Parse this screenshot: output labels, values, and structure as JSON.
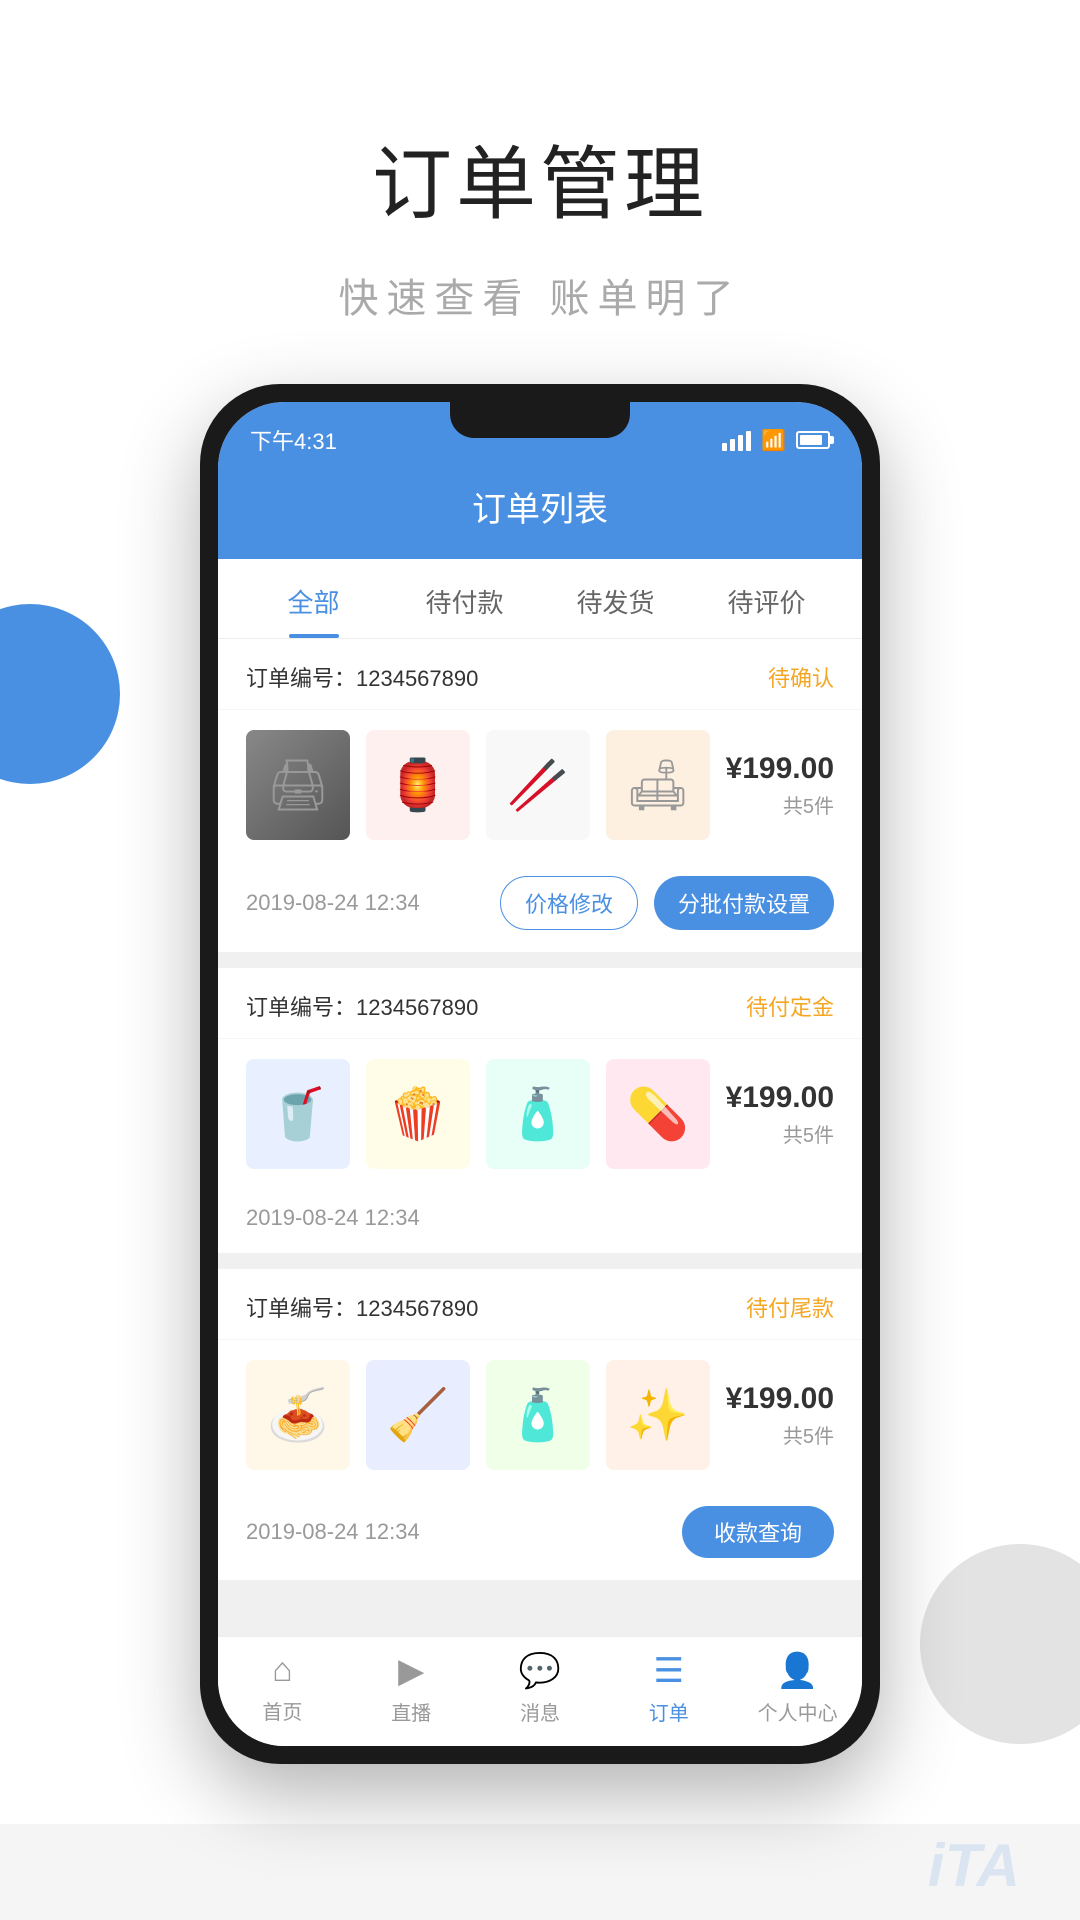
{
  "promo": {
    "title": "订单管理",
    "subtitle": "快速查看  账单明了"
  },
  "status_bar": {
    "time": "下午4:31",
    "signal": "signal",
    "wifi": "wifi",
    "battery": "battery"
  },
  "app_header": {
    "title": "订单列表"
  },
  "tabs": [
    {
      "label": "全部",
      "active": true
    },
    {
      "label": "待付款",
      "active": false
    },
    {
      "label": "待发货",
      "active": false
    },
    {
      "label": "待评价",
      "active": false
    }
  ],
  "orders": [
    {
      "id_label": "订单编号：1234567890",
      "status": "待确认",
      "products": [
        "printer",
        "decoration",
        "sticks",
        "furniture"
      ],
      "price": "¥199.00",
      "count": "共5件",
      "date": "2019-08-24 12:34",
      "actions": [
        {
          "label": "价格修改",
          "type": "outline"
        },
        {
          "label": "分批付款设置",
          "type": "primary"
        }
      ]
    },
    {
      "id_label": "订单编号：1234567890",
      "status": "待付定金",
      "products": [
        "drink",
        "snack",
        "cream",
        "medicine"
      ],
      "price": "¥199.00",
      "count": "共5件",
      "date": "2019-08-24 12:34",
      "actions": []
    },
    {
      "id_label": "订单编号：1234567890",
      "status": "待付尾款",
      "products": [
        "pasta",
        "detergent",
        "lotion",
        "perfume"
      ],
      "price": "¥199.00",
      "count": "共5件",
      "date": "2019-08-24 12:34",
      "actions": [
        {
          "label": "收款查询",
          "type": "primary-sm"
        }
      ]
    }
  ],
  "bottom_nav": [
    {
      "label": "首页",
      "icon": "home",
      "active": false
    },
    {
      "label": "直播",
      "icon": "live",
      "active": false
    },
    {
      "label": "消息",
      "icon": "message",
      "active": false
    },
    {
      "label": "订单",
      "icon": "order",
      "active": true
    },
    {
      "label": "个人中心",
      "icon": "profile",
      "active": false
    }
  ],
  "watermark": "iTA"
}
